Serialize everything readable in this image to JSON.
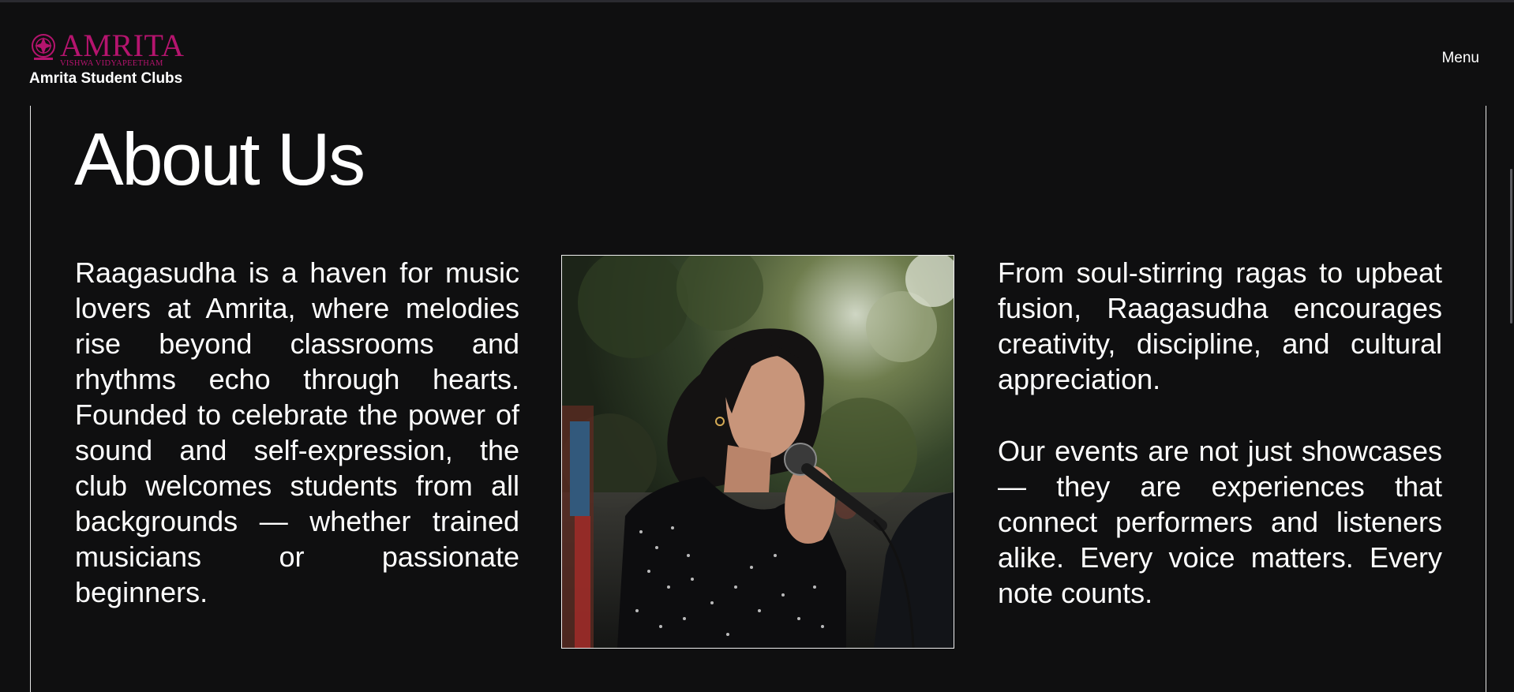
{
  "header": {
    "logo_word": "AMRITA",
    "logo_sub": "VISHWA VIDYAPEETHAM",
    "site_name": "Amrita Student Clubs",
    "menu_label": "Menu"
  },
  "main": {
    "title": "About Us",
    "left_paragraph": "Raagasudha is a haven for music lovers at Amrita, where melodies rise beyond classrooms and rhythms echo through hearts. Founded to celebrate the power of sound and self-expression, the club welcomes students from all backgrounds — whether trained musicians or passionate beginners.",
    "right_paragraph_1": "From soul-stirring ragas to upbeat fusion, Raagasudha encourages creativity, discipline, and cultural appreciation.",
    "right_paragraph_2": "Our events are not just showcases — they are experiences that connect performers and listeners alike. Every voice matters. Every note counts.",
    "photo_icon": "singer-photo"
  },
  "colors": {
    "background": "#0f0f10",
    "brand": "#b5146e",
    "text": "#ffffff"
  }
}
